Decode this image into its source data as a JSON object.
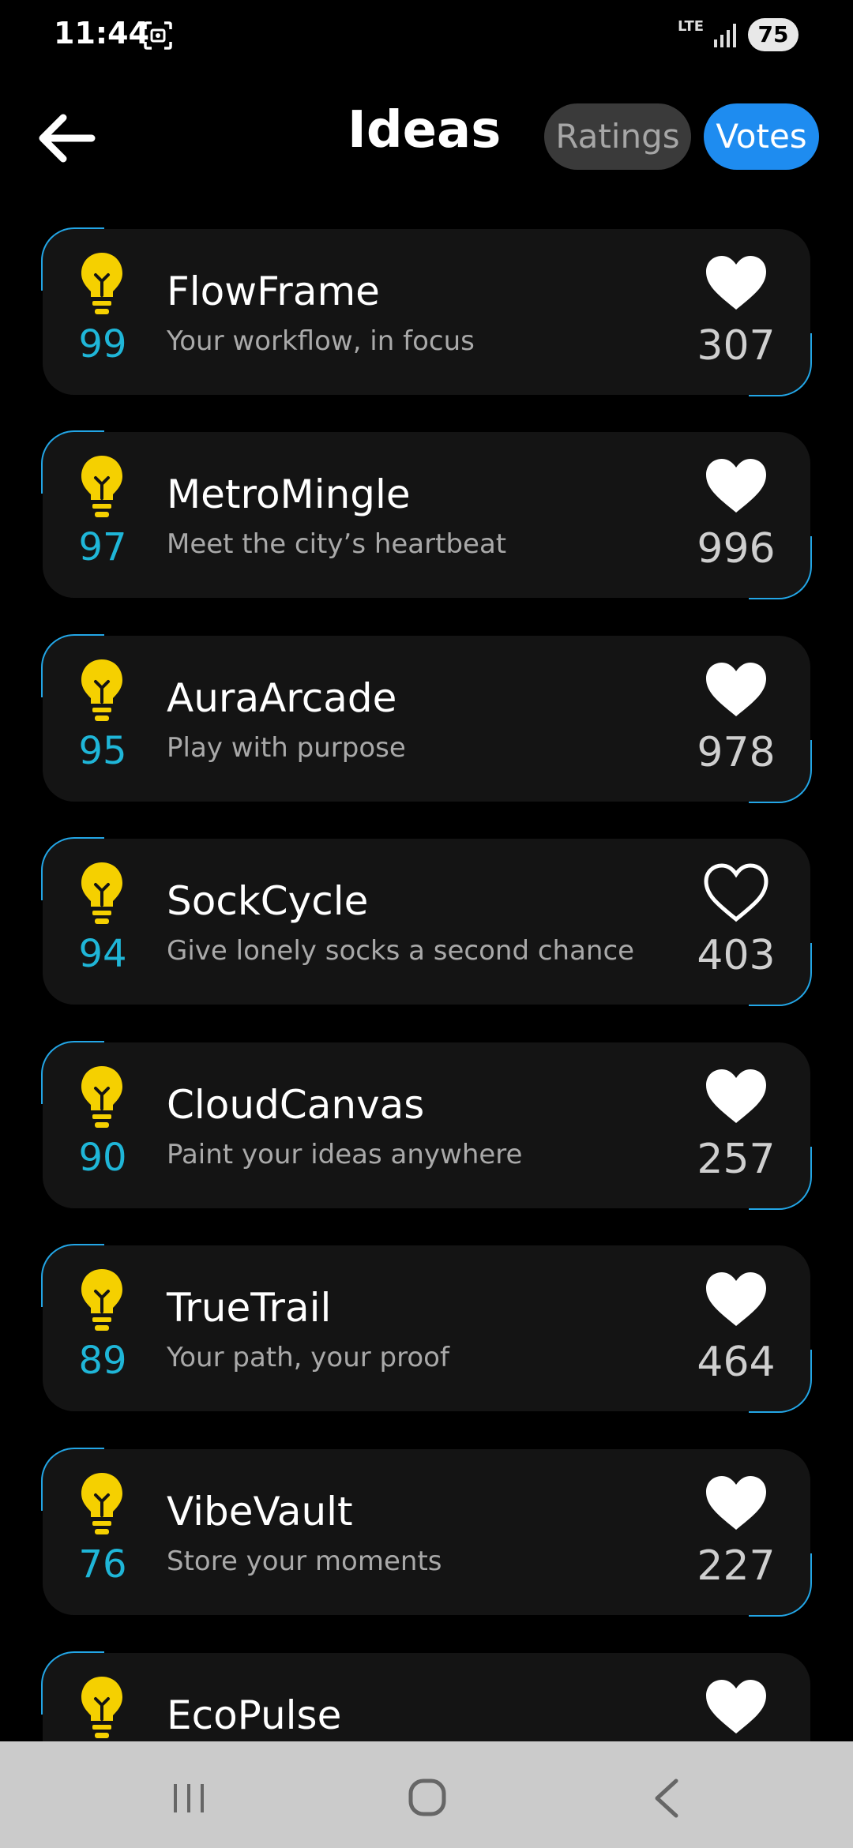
{
  "status_bar": {
    "time": "11:44",
    "network": "LTE",
    "battery": "75"
  },
  "header": {
    "title": "Ideas",
    "sort_options": [
      "Ratings",
      "Votes"
    ],
    "active_sort": "Votes"
  },
  "ideas": [
    {
      "name": "FlowFrame",
      "tagline": "Your workflow, in focus",
      "score": "99",
      "votes": "307",
      "liked": true
    },
    {
      "name": "MetroMingle",
      "tagline": "Meet the city’s heartbeat",
      "score": "97",
      "votes": "996",
      "liked": true
    },
    {
      "name": "AuraArcade",
      "tagline": "Play with purpose",
      "score": "95",
      "votes": "978",
      "liked": true
    },
    {
      "name": "SockCycle",
      "tagline": "Give lonely socks a second chance",
      "score": "94",
      "votes": "403",
      "liked": false
    },
    {
      "name": "CloudCanvas",
      "tagline": "Paint your ideas anywhere",
      "score": "90",
      "votes": "257",
      "liked": true
    },
    {
      "name": "TrueTrail",
      "tagline": "Your path, your proof",
      "score": "89",
      "votes": "464",
      "liked": true
    },
    {
      "name": "VibeVault",
      "tagline": "Store your moments",
      "score": "76",
      "votes": "227",
      "liked": true
    },
    {
      "name": "EcoPulse",
      "tagline": "",
      "score": "",
      "votes": "",
      "liked": true
    }
  ],
  "colors": {
    "accent": "#1e8cf0",
    "score": "#1fb6d8",
    "bulb": "#f5d000",
    "card": "#141414"
  },
  "icons": {
    "back": "arrow-left-icon",
    "idea": "lightbulb-icon",
    "like": "heart-icon",
    "nav_recents": "recents-icon",
    "nav_home": "home-icon",
    "nav_back": "chevron-left-icon"
  }
}
